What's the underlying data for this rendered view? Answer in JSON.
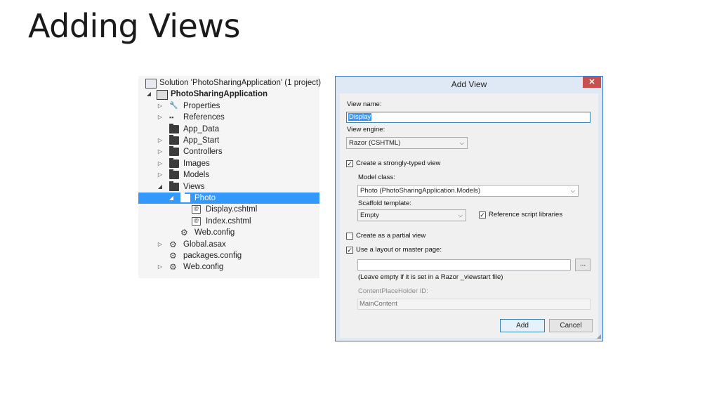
{
  "slide": {
    "title": "Adding Views"
  },
  "solution_explorer": {
    "items": [
      {
        "label": "Solution 'PhotoSharingApplication' (1 project)",
        "arrow": "",
        "icon": "solution-icon"
      },
      {
        "label": "PhotoSharingApplication",
        "arrow": "◢",
        "icon": "project-icon",
        "bold": true
      },
      {
        "label": "Properties",
        "arrow": "▷",
        "icon": "wrench-icon"
      },
      {
        "label": "References",
        "arrow": "▷",
        "icon": "references-icon"
      },
      {
        "label": "App_Data",
        "arrow": "",
        "icon": "folder-icon"
      },
      {
        "label": "App_Start",
        "arrow": "▷",
        "icon": "folder-icon"
      },
      {
        "label": "Controllers",
        "arrow": "▷",
        "icon": "folder-icon"
      },
      {
        "label": "Images",
        "arrow": "▷",
        "icon": "folder-icon"
      },
      {
        "label": "Models",
        "arrow": "▷",
        "icon": "folder-icon"
      },
      {
        "label": "Views",
        "arrow": "◢",
        "icon": "open-folder-icon"
      },
      {
        "label": "Photo",
        "arrow": "◢",
        "icon": "open-folder-icon",
        "selected": true
      },
      {
        "label": "Display.cshtml",
        "arrow": "",
        "icon": "cshtml-file-icon"
      },
      {
        "label": "Index.cshtml",
        "arrow": "",
        "icon": "cshtml-file-icon"
      },
      {
        "label": "Web.config",
        "arrow": "",
        "icon": "config-file-icon"
      },
      {
        "label": "Global.asax",
        "arrow": "▷",
        "icon": "config-file-icon"
      },
      {
        "label": "packages.config",
        "arrow": "",
        "icon": "config-file-icon"
      },
      {
        "label": "Web.config",
        "arrow": "▷",
        "icon": "config-file-icon"
      }
    ]
  },
  "dialog": {
    "title": "Add View",
    "close_glyph": "✕",
    "view_name_label": "View name:",
    "view_name_value": "Display",
    "view_engine_label": "View engine:",
    "view_engine_value": "Razor (CSHTML)",
    "strongly_typed_label": "Create a strongly-typed view",
    "strongly_typed_checked": true,
    "model_class_label": "Model class:",
    "model_class_value": "Photo (PhotoSharingApplication.Models)",
    "scaffold_label": "Scaffold template:",
    "scaffold_value": "Empty",
    "reference_scripts_label": "Reference script libraries",
    "reference_scripts_checked": true,
    "partial_view_label": "Create as a partial view",
    "partial_view_checked": false,
    "use_layout_label": "Use a layout or master page:",
    "use_layout_checked": true,
    "layout_path_value": "",
    "browse_label": "...",
    "layout_hint": "(Leave empty if it is set in a Razor _viewstart file)",
    "placeholder_id_label": "ContentPlaceHolder ID:",
    "placeholder_id_value": "MainContent",
    "add_label": "Add",
    "cancel_label": "Cancel",
    "check_glyph": "✓",
    "chevron_glyph": "⌵"
  }
}
